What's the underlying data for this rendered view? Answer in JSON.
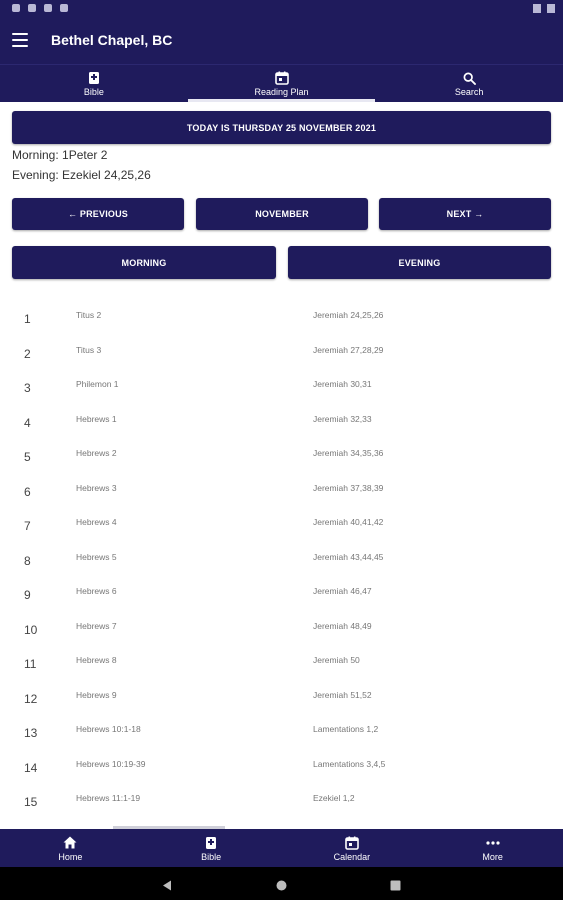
{
  "app_bar": {
    "title": "Bethel Chapel, BC"
  },
  "top_tabs": [
    {
      "label": "Bible",
      "icon": "book-icon"
    },
    {
      "label": "Reading Plan",
      "icon": "calendar-icon",
      "active": true
    },
    {
      "label": "Search",
      "icon": "search-icon"
    }
  ],
  "today_button": "TODAY IS THURSDAY 25 NOVEMBER 2021",
  "reading": {
    "morning": "Morning: 1Peter 2",
    "evening": "Evening: Ezekiel 24,25,26"
  },
  "month_nav": {
    "previous": "← PREVIOUS",
    "current": "NOVEMBER",
    "next": "NEXT →"
  },
  "toggles": {
    "morning": "MORNING",
    "evening": "EVENING"
  },
  "plan_rows": [
    {
      "day": "1",
      "morning": "Titus 2",
      "evening": "Jeremiah 24,25,26"
    },
    {
      "day": "2",
      "morning": "Titus 3",
      "evening": "Jeremiah 27,28,29"
    },
    {
      "day": "3",
      "morning": "Philemon 1",
      "evening": "Jeremiah 30,31"
    },
    {
      "day": "4",
      "morning": "Hebrews 1",
      "evening": "Jeremiah 32,33"
    },
    {
      "day": "5",
      "morning": "Hebrews 2",
      "evening": "Jeremiah 34,35,36"
    },
    {
      "day": "6",
      "morning": "Hebrews 3",
      "evening": "Jeremiah 37,38,39"
    },
    {
      "day": "7",
      "morning": "Hebrews 4",
      "evening": "Jeremiah 40,41,42"
    },
    {
      "day": "8",
      "morning": "Hebrews 5",
      "evening": "Jeremiah 43,44,45"
    },
    {
      "day": "9",
      "morning": "Hebrews 6",
      "evening": "Jeremiah 46,47"
    },
    {
      "day": "10",
      "morning": "Hebrews 7",
      "evening": "Jeremiah 48,49"
    },
    {
      "day": "11",
      "morning": "Hebrews 8",
      "evening": "Jeremiah 50"
    },
    {
      "day": "12",
      "morning": "Hebrews 9",
      "evening": "Jeremiah 51,52"
    },
    {
      "day": "13",
      "morning": "Hebrews 10:1-18",
      "evening": "Lamentations 1,2"
    },
    {
      "day": "14",
      "morning": "Hebrews 10:19-39",
      "evening": "Lamentations 3,4,5"
    },
    {
      "day": "15",
      "morning": "Hebrews 11:1-19",
      "evening": "Ezekiel 1,2"
    }
  ],
  "bottom_nav": [
    {
      "label": "Home",
      "icon": "home-icon"
    },
    {
      "label": "Bible",
      "icon": "book-icon"
    },
    {
      "label": "Calendar",
      "icon": "calendar-icon"
    },
    {
      "label": "More",
      "icon": "more-icon"
    }
  ],
  "colors": {
    "primary": "#1f1b5c",
    "background": "#ffffff",
    "muted_text": "#777777"
  }
}
